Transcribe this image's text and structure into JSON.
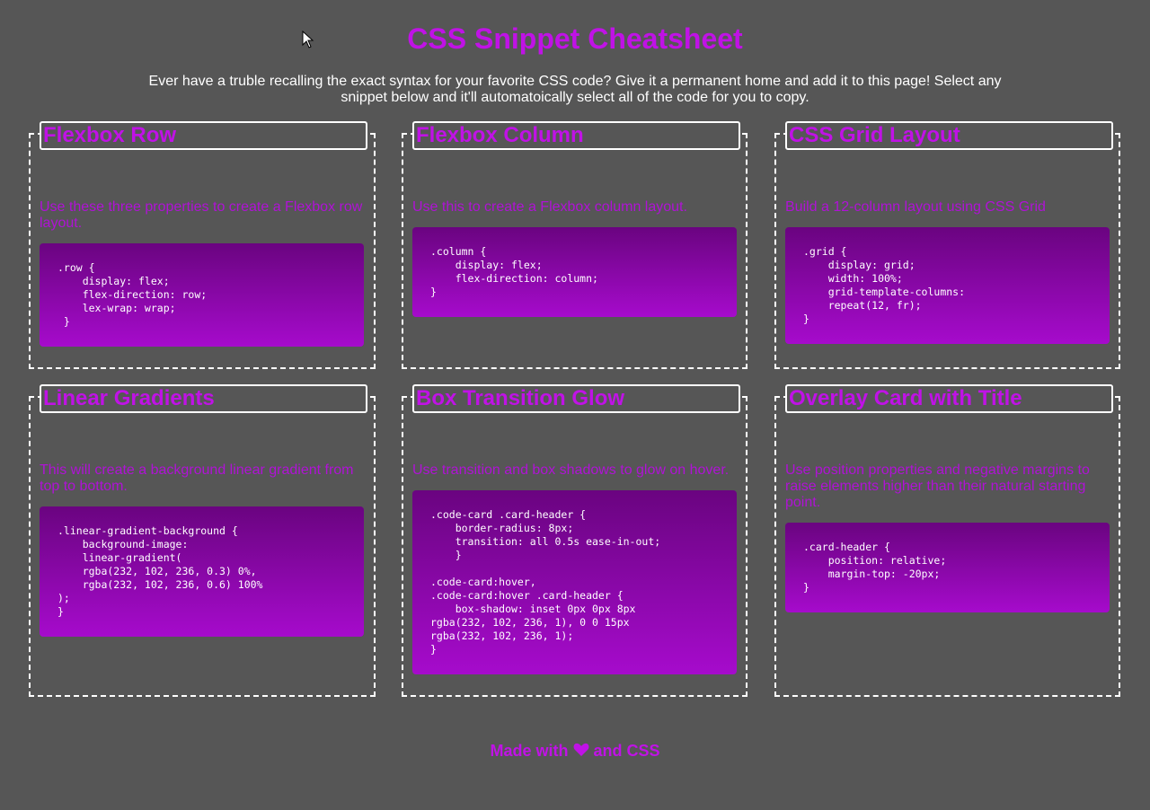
{
  "header": {
    "title": "CSS Snippet Cheatsheet",
    "intro": "Ever have a truble recalling the exact syntax for your favorite CSS code? Give it a permanent home and add it to this page! Select any snippet below and it'll automatoically select all of the code for you to copy."
  },
  "cards": [
    {
      "title": "Flexbox Row",
      "description": "Use these three properties to create a Flexbox row layout.",
      "code": ".row {\n    display: flex;\n    flex-direction: row;\n    lex-wrap: wrap;\n }"
    },
    {
      "title": "Flexbox Column",
      "description": "Use this to create a Flexbox column layout.",
      "code": ".column {\n    display: flex;\n    flex-direction: column;\n}"
    },
    {
      "title": "CSS Grid Layout",
      "description": "Build a 12-column layout using CSS Grid",
      "code": ".grid {\n    display: grid;\n    width: 100%;\n    grid-template-columns:\n    repeat(12, fr);\n}"
    },
    {
      "title": "Linear Gradients",
      "description": "This will create a background linear gradient from top to bottom.",
      "code": ".linear-gradient-background {\n    background-image:\n    linear-gradient(\n    rgba(232, 102, 236, 0.3) 0%,\n    rgba(232, 102, 236, 0.6) 100%\n);\n}"
    },
    {
      "title": "Box Transition Glow",
      "description": "Use transition and box shadows to glow on hover.",
      "code": ".code-card .card-header {\n    border-radius: 8px;\n    transition: all 0.5s ease-in-out;\n    }\n\n.code-card:hover,\n.code-card:hover .card-header {\n    box-shadow: inset 0px 0px 8px\nrgba(232, 102, 236, 1), 0 0 15px\nrgba(232, 102, 236, 1);\n}"
    },
    {
      "title": "Overlay Card with Title",
      "description": "Use position properties and negative margins to raise elements higher than their natural starting point.",
      "code": ".card-header {\n    position: relative;\n    margin-top: -20px;\n}"
    }
  ],
  "footer": {
    "prefix": "Made with",
    "icon": "heart-icon",
    "suffix": "and CSS"
  },
  "colors": {
    "background": "#565656",
    "accent": "#c012e6",
    "code_gradient_top": "#6a0480",
    "code_gradient_bottom": "#a60bcc"
  }
}
